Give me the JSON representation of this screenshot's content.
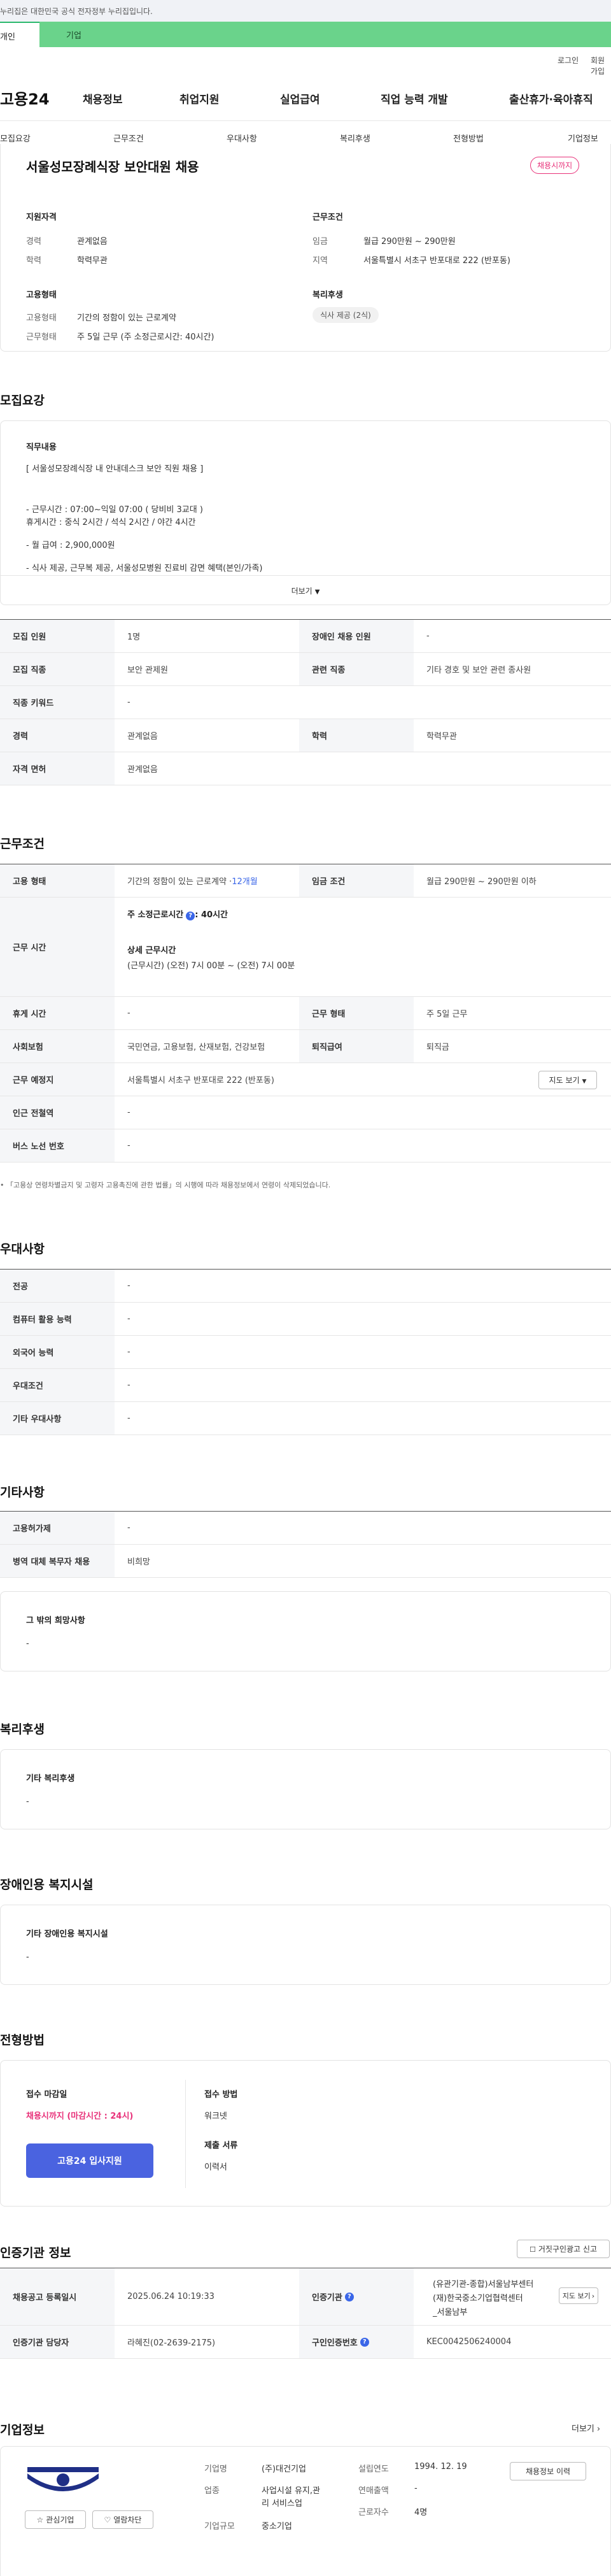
{
  "gov_notice": "누리집은 대한민국 공식 전자정부 누리집입니다.",
  "top_tabs": {
    "personal": "개인",
    "company": "기업"
  },
  "util": {
    "login": "로그인",
    "signup": "회원가입"
  },
  "logo": "고용24",
  "gnb": [
    "채용정보",
    "취업지원",
    "실업급여",
    "직업 능력 개발",
    "출산휴가·육아휴직"
  ],
  "snb": [
    "모집요강",
    "근무조건",
    "우대사항",
    "복리후생",
    "전형방법",
    "기업정보"
  ],
  "summary": {
    "title": "서울성모장례식장 보안대원 채용",
    "badge": "채용시까지",
    "qual_head": "지원자격",
    "career_label": "경력",
    "career_value": "관계없음",
    "edu_label": "학력",
    "edu_value": "학력무관",
    "cond_head": "근무조건",
    "wage_label": "임금",
    "wage_value": "월급 290만원 ~ 290만원",
    "region_label": "지역",
    "region_value": "서울특별시 서초구 반포대로 222 (반포동)",
    "emp_head": "고용형태",
    "emptype_label": "고용형태",
    "emptype_value": "기간의 정함이 있는 근로계약",
    "worktype_label": "근무형태",
    "worktype_value": "주 5일 근무 (주 소정근로시간: 40시간)",
    "welfare_head": "복리후생",
    "welfare_pill": "식사 제공 (2식)"
  },
  "recruit": {
    "heading": "모집요강",
    "job_head": "직무내용",
    "lines": [
      "[ 서울성모장례식장 내 안내데스크 보안 직원 채용 ]",
      "- 근무시간 : 07:00~익일 07:00 ( 당비비 3교대 )",
      "휴게시간 : 중식 2시간 / 석식 2시간 / 야간 4시간",
      "- 월 급여 : 2,900,000원",
      "- 식사 제공, 근무복 제공, 서울성모병원 진료비 감면 혜택(본인/가족)"
    ],
    "more": "더보기",
    "rows": [
      {
        "l1": "모집 인원",
        "v1": "1명",
        "l2": "장애인 채용 인원",
        "v2": "-"
      },
      {
        "l1": "모집 직종",
        "v1": "보안 관제원",
        "l2": "관련 직종",
        "v2": "기타 경호 및 보안 관련 종사원"
      },
      {
        "l1": "직종 키워드",
        "v1": "-"
      },
      {
        "l1": "경력",
        "v1": "관계없음",
        "l2": "학력",
        "v2": "학력무관"
      },
      {
        "l1": "자격 면허",
        "v1": "관계없음"
      }
    ]
  },
  "work": {
    "heading": "근무조건",
    "emp_label": "고용 형태",
    "emp_value": "기간의 정함이 있는 근로계약 · ",
    "emp_months": "12개월",
    "wage_label": "임금 조건",
    "wage_value": "월급 290만원 ~ 290만원 이하",
    "hours_label": "근무 시간",
    "hours_main": "주 소정근로시간",
    "hours_main_val": ": 40시간",
    "hours_detail_head": "상세 근무시간",
    "hours_detail": "(근무시간) (오전) 7시 00분 ~ (오전) 7시 00분",
    "rest_label": "휴게 시간",
    "rest_value": "-",
    "form_label": "근무 형태",
    "form_value": "주 5일 근무",
    "ins_label": "사회보험",
    "ins_value": "국민연금, 고용보험, 산재보험, 건강보험",
    "sev_label": "퇴직급여",
    "sev_value": "퇴직금",
    "place_label": "근무 예정지",
    "place_value": "서울특별시 서초구 반포대로 222 (반포동)",
    "map_btn": "지도 보기",
    "subway_label": "인근 전철역",
    "subway_value": "-",
    "bus_label": "버스 노선 번호",
    "bus_value": "-",
    "note": "「고용상 연령차별금지 및 고령자 고용촉진에 관한 법률」의 시행에 따라 채용정보에서 연령이 삭제되었습니다."
  },
  "pref": {
    "heading": "우대사항",
    "rows": [
      {
        "l": "전공",
        "v": "-"
      },
      {
        "l": "컴퓨터 활용 능력",
        "v": "-"
      },
      {
        "l": "외국어 능력",
        "v": "-"
      },
      {
        "l": "우대조건",
        "v": "-"
      },
      {
        "l": "기타 우대사항",
        "v": "-"
      }
    ]
  },
  "etc": {
    "heading": "기타사항",
    "rows": [
      {
        "l": "고용허가제",
        "v": "-"
      },
      {
        "l": "병역 대체 복무자 채용",
        "v": "비희망"
      }
    ],
    "wish_head": "그 밖의 희망사항",
    "wish_value": "-"
  },
  "welfare": {
    "heading": "복리후생",
    "sub": "기타 복리후생",
    "value": "-"
  },
  "disabled": {
    "heading": "장애인용 복지시설",
    "sub": "기타 장애인용 복지시설",
    "value": "-"
  },
  "screening": {
    "heading": "전형방법",
    "deadline_head": "접수 마감일",
    "deadline_value": "채용시까지 (마감시간 : 24시)",
    "apply_btn": "고용24 입사지원",
    "method_head": "접수 방법",
    "method_value": "워크넷",
    "docs_head": "제출 서류",
    "docs_value": "이력서"
  },
  "cert": {
    "heading": "인증기관 정보",
    "report_btn": "거짓구인광고 신고",
    "reg_label": "채용공고 등록일시",
    "reg_value": "2025.06.24 10:19:33",
    "org_label": "인증기관",
    "org_value_1": "(유관기관-종합)서울남부센터",
    "org_value_2": "(재)한국중소기업협력센터",
    "org_value_3": "_서울남부",
    "map_btn": "지도 보기",
    "mgr_label": "인증기관 담당자",
    "mgr_value": "라혜진(02-2639-2175)",
    "no_label": "구인인증번호",
    "no_value": "KEC0042506240004"
  },
  "company": {
    "heading": "기업정보",
    "more": "더보기",
    "fav_btn": "관심기업",
    "block_btn": "열람차단",
    "name_label": "기업명",
    "name_value": "(주)대건기업",
    "ind_label": "업종",
    "ind_value_1": "사업시설 유지,관",
    "ind_value_2": "리 서비스업",
    "size_label": "기업규모",
    "size_value": "중소기업",
    "est_label": "설립연도",
    "est_value": "1994. 12. 19",
    "sales_label": "연매출액",
    "sales_value": "-",
    "emp_label": "근로자수",
    "emp_value": "4명",
    "hist_btn": "채용정보 이력"
  }
}
